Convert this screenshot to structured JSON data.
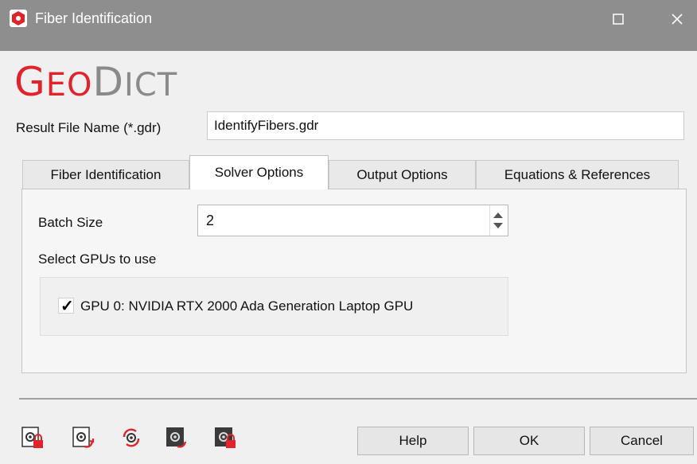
{
  "window": {
    "title": "Fiber Identification",
    "brand_part1": "G",
    "brand_part2": "EO",
    "brand_part3": "D",
    "brand_part4": "ICT"
  },
  "result": {
    "label": "Result File Name (*.gdr)",
    "value": "IdentifyFibers.gdr"
  },
  "tabs": [
    {
      "label": "Fiber Identification"
    },
    {
      "label": "Solver Options"
    },
    {
      "label": "Output Options"
    },
    {
      "label": "Equations & References"
    }
  ],
  "active_tab": "Solver Options",
  "solver": {
    "batch_label": "Batch Size",
    "batch_value": "2",
    "gpu_section_label": "Select GPUs to use",
    "gpus": [
      {
        "label": "GPU 0: NVIDIA RTX 2000 Ada Generation Laptop GPU",
        "checked": true
      }
    ]
  },
  "footer": {
    "tools": [
      "gear-lock-icon",
      "gear-export-icon",
      "gear-refresh-icon",
      "dark-gear-export-icon",
      "dark-gear-lock-icon"
    ],
    "help_label": "Help",
    "ok_label": "OK",
    "cancel_label": "Cancel"
  },
  "colors": {
    "brand_red": "#e1242c",
    "brand_gray": "#8a8a8a",
    "title_bar": "#8e8e8e"
  }
}
